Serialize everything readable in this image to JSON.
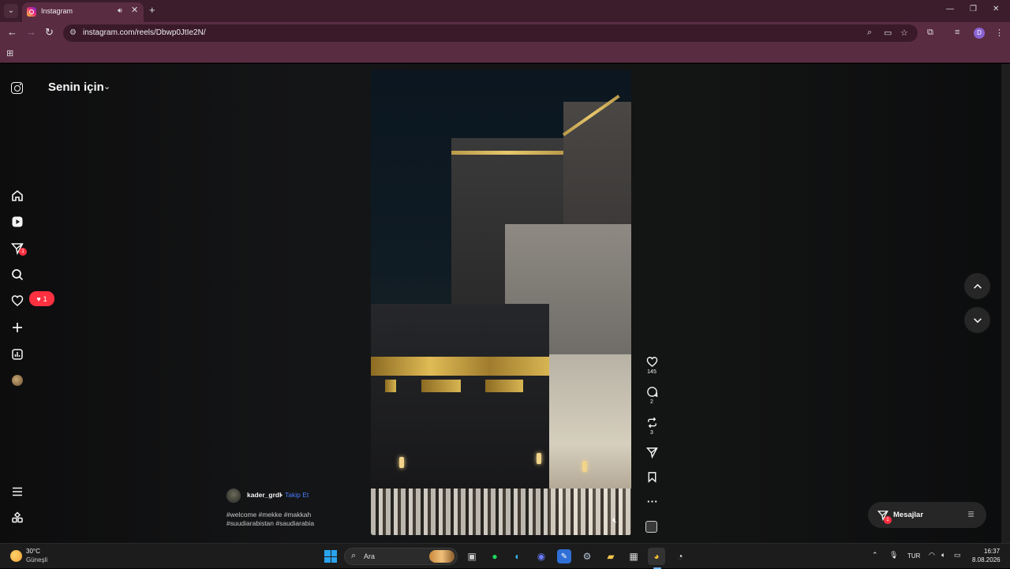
{
  "browser": {
    "tab_title": "Instagram",
    "url": "instagram.com/reels/Dbwp0JtIe2N/",
    "profile_initial": "D",
    "new_tab": "+",
    "close": "✕",
    "minimize": "—",
    "restore": "❐"
  },
  "instagram": {
    "feed_title": "Senin için",
    "sidebar": {
      "notification_count": "1",
      "messages_badge": "1"
    },
    "reel": {
      "likes": "145",
      "comments": "2",
      "reposts": "3"
    },
    "author": {
      "username": "kader_grdl",
      "separator": "•",
      "follow_label": "Takip Et"
    },
    "caption": "#welcome #mekke #makkah #suudiarabistan #saudiarabia",
    "messages": {
      "label": "Mesajlar",
      "badge": "1"
    }
  },
  "taskbar": {
    "weather_temp": "30°C",
    "weather_desc": "Güneşli",
    "search_placeholder": "Ara",
    "language": "TUR",
    "time": "16:37",
    "date": "8.08.2026"
  },
  "colors": {
    "accent_red": "#ff3040",
    "follow_blue": "#4a7bff",
    "browser_frame": "#5a2c42"
  }
}
